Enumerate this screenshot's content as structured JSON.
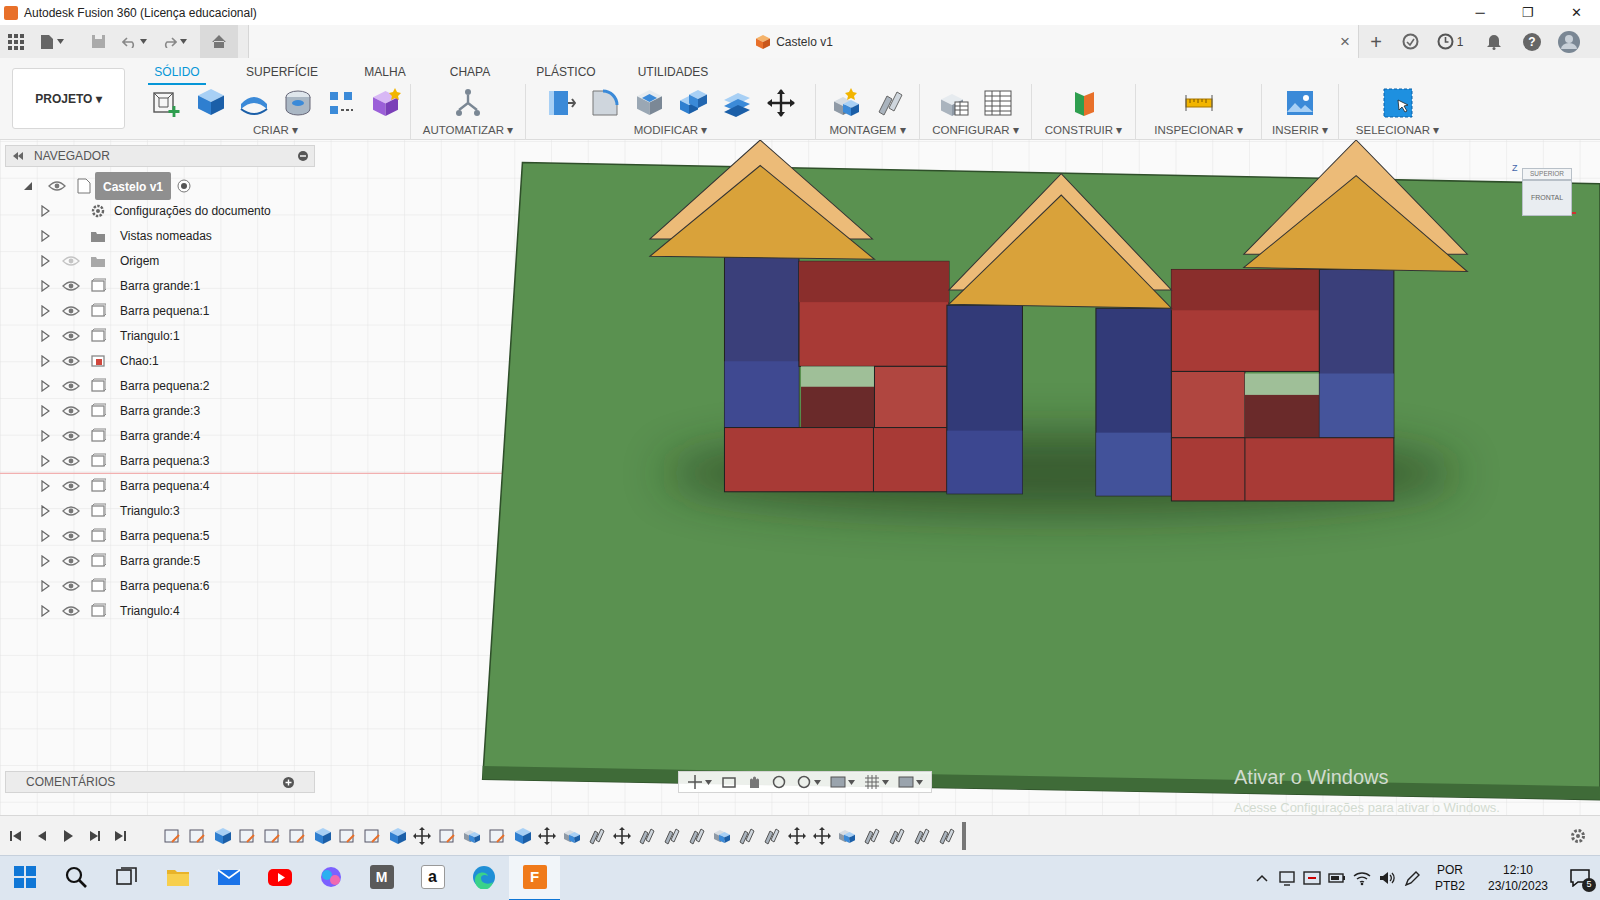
{
  "window": {
    "title": "Autodesk Fusion 360 (Licença educacional)",
    "controls": [
      "─",
      "❐",
      "✕"
    ]
  },
  "document_tab": {
    "title": "Castelo v1",
    "close": "×"
  },
  "top_bar": {
    "new_tab": "+",
    "jobs": "1",
    "help": "?"
  },
  "project_button": {
    "label": "PROJETO ▾"
  },
  "workspace_tabs": [
    {
      "label": "SÓLIDO",
      "selected": true
    },
    {
      "label": "SUPERFÍCIE",
      "selected": false
    },
    {
      "label": "MALHA",
      "selected": false
    },
    {
      "label": "CHAPA",
      "selected": false
    },
    {
      "label": "PLÁSTICO",
      "selected": false
    },
    {
      "label": "UTILIDADES",
      "selected": false
    }
  ],
  "tool_groups": [
    {
      "label": "CRIAR ▾"
    },
    {
      "label": "AUTOMATIZAR ▾"
    },
    {
      "label": "MODIFICAR ▾"
    },
    {
      "label": "MONTAGEM ▾"
    },
    {
      "label": "CONFIGURAR ▾"
    },
    {
      "label": "CONSTRUIR ▾"
    },
    {
      "label": "INSPECIONAR ▾"
    },
    {
      "label": "INSERIR ▾"
    },
    {
      "label": "SELECIONAR ▾"
    }
  ],
  "navigator": {
    "title": "NAVEGADOR",
    "root": {
      "label": "Castelo v1",
      "expanded": true,
      "visible": true
    },
    "items": [
      {
        "label": "Configurações do documento",
        "kind": "settings",
        "expanded": false,
        "visible": true
      },
      {
        "label": "Vistas nomeadas",
        "kind": "views",
        "expanded": false,
        "visible": true
      },
      {
        "label": "Origem",
        "kind": "origin",
        "expanded": false,
        "visible": false
      },
      {
        "label": "Barra grande:1",
        "kind": "body",
        "expanded": false,
        "visible": true
      },
      {
        "label": "Barra pequena:1",
        "kind": "body",
        "expanded": false,
        "visible": true
      },
      {
        "label": "Triangulo:1",
        "kind": "body",
        "expanded": false,
        "visible": true
      },
      {
        "label": "Chao:1",
        "kind": "component",
        "expanded": false,
        "visible": true
      },
      {
        "label": "Barra pequena:2",
        "kind": "body",
        "expanded": false,
        "visible": true
      },
      {
        "label": "Barra grande:3",
        "kind": "body",
        "expanded": false,
        "visible": true
      },
      {
        "label": "Barra grande:4",
        "kind": "body",
        "expanded": false,
        "visible": true
      },
      {
        "label": "Barra pequena:3",
        "kind": "body",
        "expanded": false,
        "visible": true
      },
      {
        "label": "Barra pequena:4",
        "kind": "body",
        "expanded": false,
        "visible": true
      },
      {
        "label": "Triangulo:3",
        "kind": "body",
        "expanded": false,
        "visible": true
      },
      {
        "label": "Barra pequena:5",
        "kind": "body",
        "expanded": false,
        "visible": true
      },
      {
        "label": "Barra grande:5",
        "kind": "body",
        "expanded": false,
        "visible": true
      },
      {
        "label": "Barra pequena:6",
        "kind": "body",
        "expanded": false,
        "visible": true
      },
      {
        "label": "Triangulo:4",
        "kind": "body",
        "expanded": false,
        "visible": true
      }
    ]
  },
  "comments": {
    "title": "COMENTÁRIOS"
  },
  "viewcube": {
    "axis": "Z",
    "top": "SUPERIOR",
    "front": "FRONTAL"
  },
  "timeline": {
    "features": [
      {
        "kind": "sketch"
      },
      {
        "kind": "sketch"
      },
      {
        "kind": "extrude"
      },
      {
        "kind": "sketch"
      },
      {
        "kind": "sketch"
      },
      {
        "kind": "sketch"
      },
      {
        "kind": "extrude"
      },
      {
        "kind": "sketch"
      },
      {
        "kind": "sketch"
      },
      {
        "kind": "extrude"
      },
      {
        "kind": "move"
      },
      {
        "kind": "sketch"
      },
      {
        "kind": "component"
      },
      {
        "kind": "sketch"
      },
      {
        "kind": "extrude"
      },
      {
        "kind": "move"
      },
      {
        "kind": "component"
      },
      {
        "kind": "joint"
      },
      {
        "kind": "move"
      },
      {
        "kind": "joint"
      },
      {
        "kind": "joint"
      },
      {
        "kind": "joint"
      },
      {
        "kind": "component"
      },
      {
        "kind": "joint"
      },
      {
        "kind": "joint"
      },
      {
        "kind": "move"
      },
      {
        "kind": "move"
      },
      {
        "kind": "component"
      },
      {
        "kind": "joint"
      },
      {
        "kind": "joint"
      },
      {
        "kind": "joint"
      },
      {
        "kind": "joint"
      }
    ]
  },
  "watermark": {
    "title": "Ativar o Windows",
    "subtitle": "Acesse Configurações para ativar o Windows."
  },
  "taskbar": {
    "apps": [
      {
        "kind": "start",
        "label": "",
        "active": false
      },
      {
        "kind": "search",
        "label": "",
        "active": false
      },
      {
        "kind": "task-view",
        "label": "",
        "active": false
      },
      {
        "kind": "explorer",
        "label": "",
        "active": false
      },
      {
        "kind": "mail",
        "label": "",
        "active": false
      },
      {
        "kind": "youtube",
        "label": "",
        "active": false
      },
      {
        "kind": "copilot",
        "label": "",
        "active": false
      },
      {
        "kind": "letter-dark",
        "label": "M",
        "active": false
      },
      {
        "kind": "letter-light",
        "label": "a",
        "active": false
      },
      {
        "kind": "edge",
        "label": "",
        "active": false
      },
      {
        "kind": "fusion",
        "label": "F",
        "active": true
      }
    ],
    "language": "POR",
    "layout": "PTB2",
    "time": "12:10",
    "date": "23/10/2023",
    "notifications": "5"
  }
}
